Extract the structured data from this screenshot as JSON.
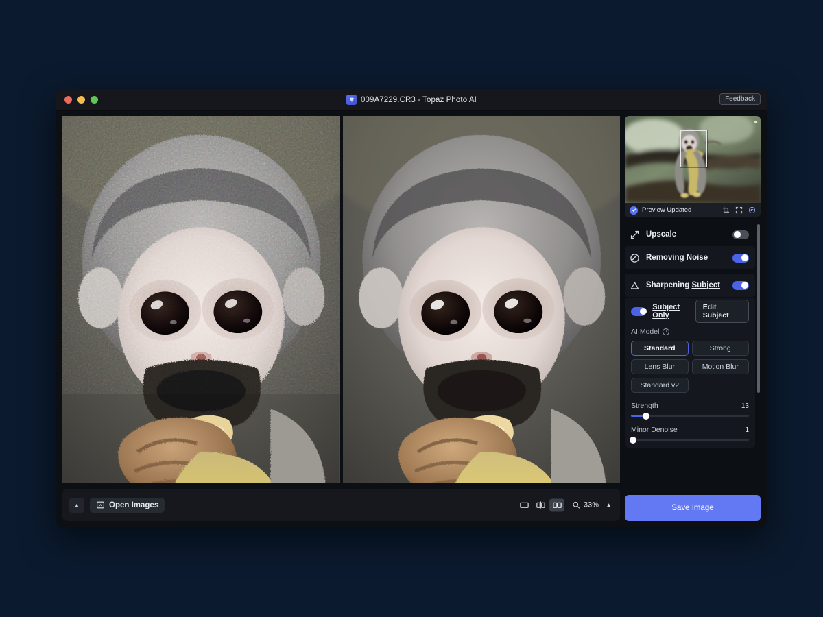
{
  "window": {
    "title": "009A7229.CR3 - Topaz Photo AI",
    "app_icon": "topaz-gem-icon",
    "feedback_label": "Feedback",
    "traffic_lights": [
      "close",
      "minimize",
      "maximize"
    ]
  },
  "preview": {
    "status_label": "Preview Updated",
    "status_icon": "check-circle-icon",
    "tool_icons": [
      "crop-icon",
      "fullscreen-icon",
      "face-compare-icon"
    ],
    "viewport_selector": true
  },
  "features": [
    {
      "name": "Upscale",
      "icon": "upscale-arrows-icon",
      "enabled": false
    },
    {
      "name": "Removing Noise",
      "icon": "denoise-circle-icon",
      "enabled": true
    },
    {
      "name": "Sharpening",
      "suffix": "Subject",
      "icon": "sharpen-triangle-icon",
      "enabled": true
    }
  ],
  "sharpen_panel": {
    "subject_only_label": "Subject Only",
    "subject_only_enabled": true,
    "edit_subject_label": "Edit Subject",
    "ai_model_label": "AI Model",
    "ai_model_info_icon": "info-icon",
    "models": [
      {
        "label": "Standard",
        "selected": true
      },
      {
        "label": "Strong",
        "selected": false
      },
      {
        "label": "Lens Blur",
        "selected": false
      },
      {
        "label": "Motion Blur",
        "selected": false
      },
      {
        "label": "Standard v2",
        "selected": false
      }
    ],
    "sliders": [
      {
        "label": "Strength",
        "value": "13",
        "percent": 13
      },
      {
        "label": "Minor Denoise",
        "value": "1",
        "percent": 1
      }
    ]
  },
  "save": {
    "label": "Save Image"
  },
  "bottom_bar": {
    "collapse_icon": "chevron-up-icon",
    "open_images_label": "Open Images",
    "open_images_icon": "open-image-icon",
    "view_modes": [
      {
        "name": "single-view",
        "icon": "single-pane-icon",
        "active": false
      },
      {
        "name": "split-view",
        "icon": "split-pane-icon",
        "active": false
      },
      {
        "name": "side-by-side-view",
        "icon": "side-by-side-icon",
        "active": true
      }
    ],
    "zoom_icon": "magnifier-icon",
    "zoom_level": "33%",
    "zoom_chevron_icon": "chevron-up-icon"
  },
  "colors": {
    "accent": "#4a63e7",
    "save_button": "#6379f4",
    "desktop_background": "#0b1a2e",
    "window_background": "#0c0f14",
    "panel_shaded": "#14171d"
  },
  "viewer": {
    "left_pane_name": "original-image-pane",
    "right_pane_name": "processed-image-pane",
    "subject": "squirrel-monkey-eating"
  }
}
